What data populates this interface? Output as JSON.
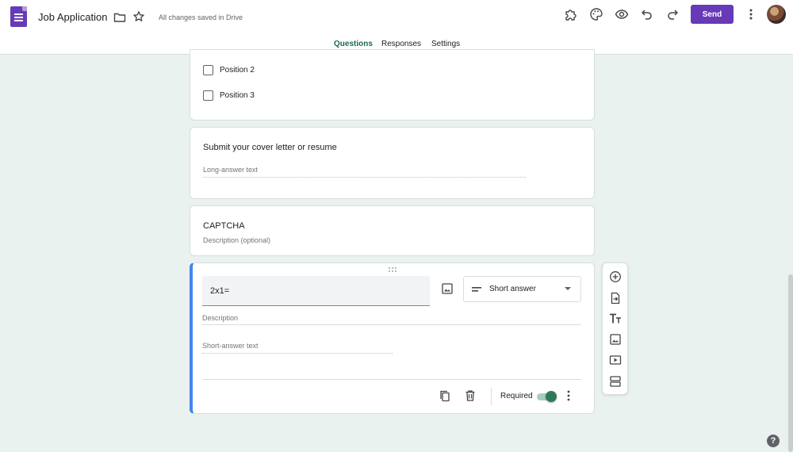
{
  "header": {
    "title": "Job Application",
    "save_status": "All changes saved in Drive",
    "send_label": "Send"
  },
  "tabs": [
    {
      "label": "Questions",
      "active": true
    },
    {
      "label": "Responses",
      "active": false
    },
    {
      "label": "Settings",
      "active": false
    }
  ],
  "cards": {
    "positions": {
      "options": [
        "Position 2",
        "Position 3"
      ]
    },
    "cover_letter": {
      "title": "Submit your cover letter or resume",
      "hint": "Long-answer text"
    },
    "captcha": {
      "title": "CAPTCHA",
      "description_placeholder": "Description (optional)"
    },
    "question": {
      "title_value": "2x1=",
      "type": "Short answer",
      "description_placeholder": "Description",
      "answer_hint": "Short-answer text",
      "required_label": "Required",
      "required": true
    }
  },
  "colors": {
    "accent": "#673ab7",
    "tab_active": "#1e6a4a",
    "active_card_border": "#4285f4",
    "background": "#e9f2ee"
  },
  "icons": {
    "header": [
      "folder-icon",
      "star-icon",
      "addon-icon",
      "palette-icon",
      "preview-icon",
      "undo-icon",
      "redo-icon",
      "more-vert-icon"
    ],
    "toolbar": [
      "add-question-icon",
      "import-questions-icon",
      "add-title-icon",
      "add-image-icon",
      "add-video-icon",
      "add-section-icon"
    ],
    "footer": [
      "duplicate-icon",
      "delete-icon",
      "more-vert-icon"
    ]
  }
}
